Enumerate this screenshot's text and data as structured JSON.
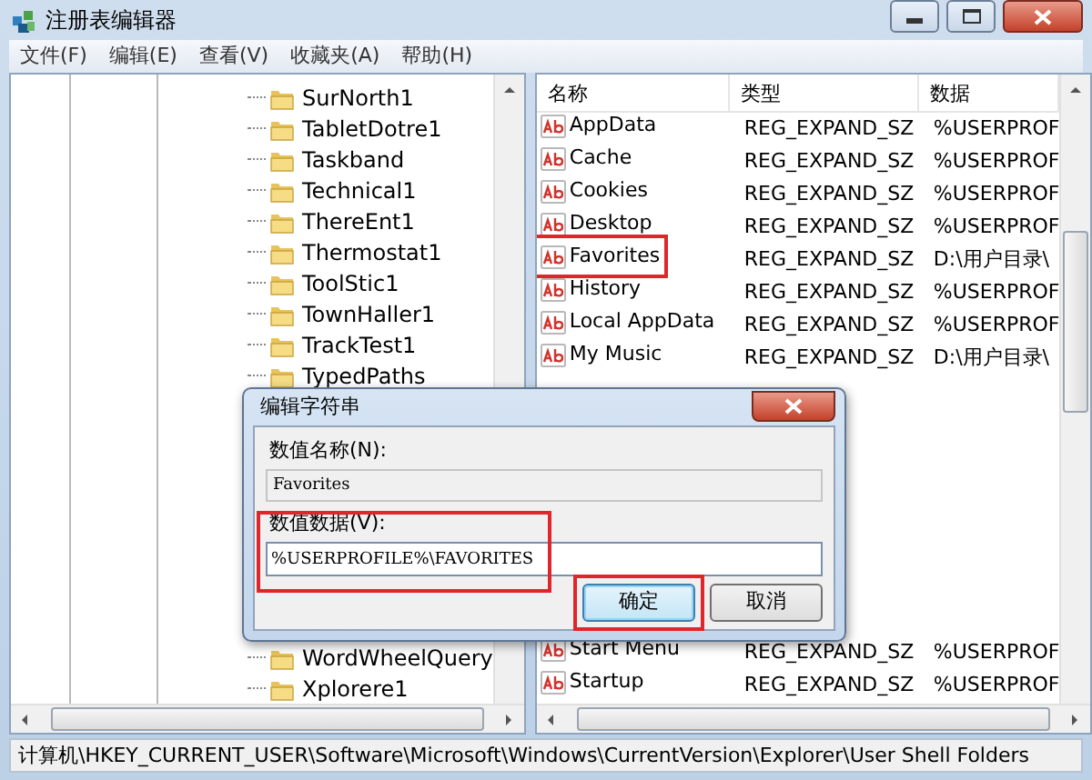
{
  "window": {
    "title": "注册表编辑器"
  },
  "menu": [
    "文件(F)",
    "编辑(E)",
    "查看(V)",
    "收藏夹(A)",
    "帮助(H)"
  ],
  "tree": {
    "items": [
      "SurNorth1",
      "TabletDotre1",
      "Taskband",
      "Technical1",
      "ThereEnt1",
      "Thermostat1",
      "ToolStic1",
      "TownHaller1",
      "TrackTest1",
      "TypedPaths"
    ],
    "items_below_dialog": [
      "WordWheelQuery",
      "Xplorere1"
    ]
  },
  "values": {
    "columns": [
      "名称",
      "类型",
      "数据"
    ],
    "rows": [
      {
        "name": "AppData",
        "type": "REG_EXPAND_SZ",
        "data": "%USERPROF",
        "highlighted": false
      },
      {
        "name": "Cache",
        "type": "REG_EXPAND_SZ",
        "data": "%USERPROF",
        "highlighted": false
      },
      {
        "name": "Cookies",
        "type": "REG_EXPAND_SZ",
        "data": "%USERPROF",
        "highlighted": false
      },
      {
        "name": "Desktop",
        "type": "REG_EXPAND_SZ",
        "data": "%USERPROF",
        "highlighted": false
      },
      {
        "name": "Favorites",
        "type": "REG_EXPAND_SZ",
        "data": "D:\\用户目录\\",
        "highlighted": true
      },
      {
        "name": "History",
        "type": "REG_EXPAND_SZ",
        "data": "%USERPROF",
        "highlighted": false
      },
      {
        "name": "Local AppData",
        "type": "REG_EXPAND_SZ",
        "data": "%USERPROF",
        "highlighted": false
      },
      {
        "name": "My Music",
        "type": "REG_EXPAND_SZ",
        "data": "D:\\用户目录\\",
        "highlighted": false
      }
    ],
    "rows_below_dialog": [
      {
        "name": "Start Menu",
        "type": "REG_EXPAND_SZ",
        "data": "%USERPROF",
        "highlighted": false
      },
      {
        "name": "Startup",
        "type": "REG_EXPAND_SZ",
        "data": "%USERPROF",
        "highlighted": false
      }
    ]
  },
  "dialog": {
    "title": "编辑字符串",
    "name_label": "数值名称(N):",
    "name_value": "Favorites",
    "data_label": "数值数据(V):",
    "data_value": "%USERPROFILE%\\FAVORITES",
    "data_highlighted": true,
    "buttons": [
      {
        "label": "确定",
        "default": true,
        "highlighted": true
      },
      {
        "label": "取消",
        "default": false,
        "highlighted": false
      }
    ]
  },
  "status_bar": "计算机\\HKEY_CURRENT_USER\\Software\\Microsoft\\Windows\\CurrentVersion\\Explorer\\User Shell Folders"
}
